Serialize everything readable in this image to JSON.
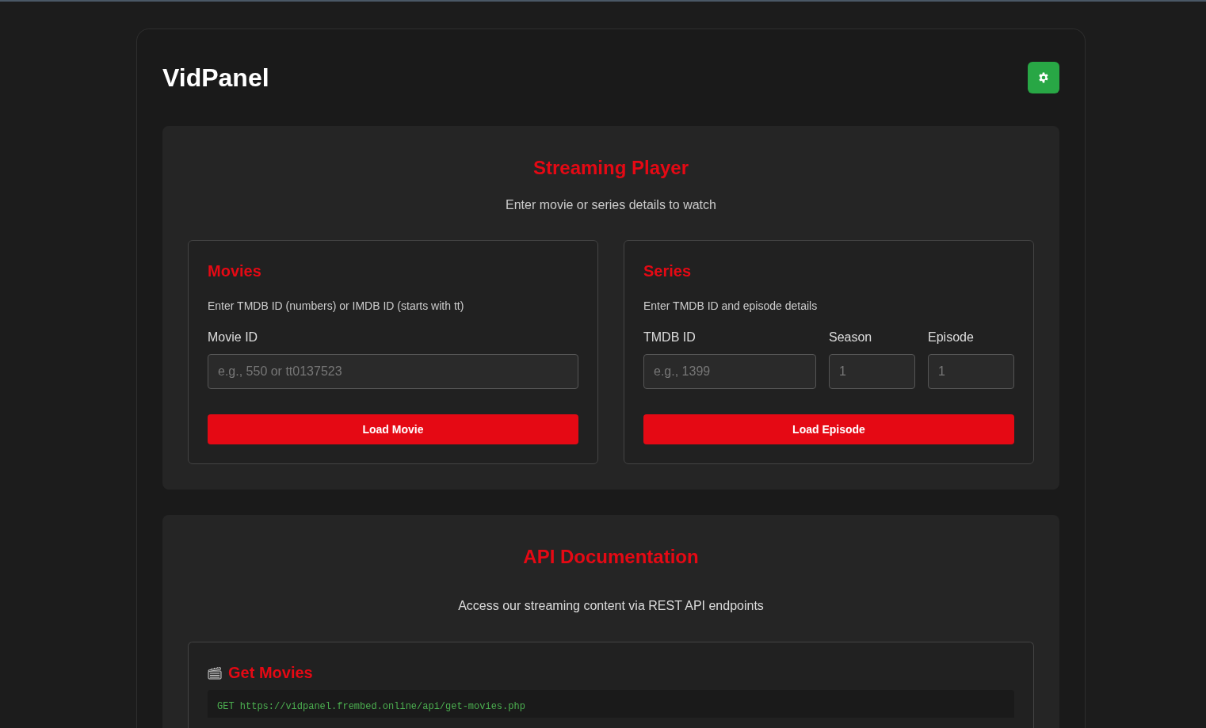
{
  "app": {
    "title": "VidPanel"
  },
  "player": {
    "title": "Streaming Player",
    "subtitle": "Enter movie or series details to watch",
    "panels": [
      {
        "title": "Movies",
        "description": "Enter TMDB ID (numbers) or IMDB ID (starts with tt)",
        "fields": [
          {
            "label": "Movie ID",
            "placeholder": "e.g., 550 or tt0137523"
          }
        ],
        "button": "Load Movie"
      },
      {
        "title": "Series",
        "description": "Enter TMDB ID and episode details",
        "fields": [
          {
            "label": "TMDB ID",
            "placeholder": "e.g., 1399"
          },
          {
            "label": "Season",
            "placeholder": "1"
          },
          {
            "label": "Episode",
            "placeholder": "1"
          }
        ],
        "button": "Load Episode"
      }
    ]
  },
  "api_docs": {
    "title": "API Documentation",
    "subtitle": "Access our streaming content via REST API endpoints",
    "endpoints": [
      {
        "title": "Get Movies",
        "request": "GET https://vidpanel.frembed.online/api/get-movies.php"
      }
    ]
  }
}
